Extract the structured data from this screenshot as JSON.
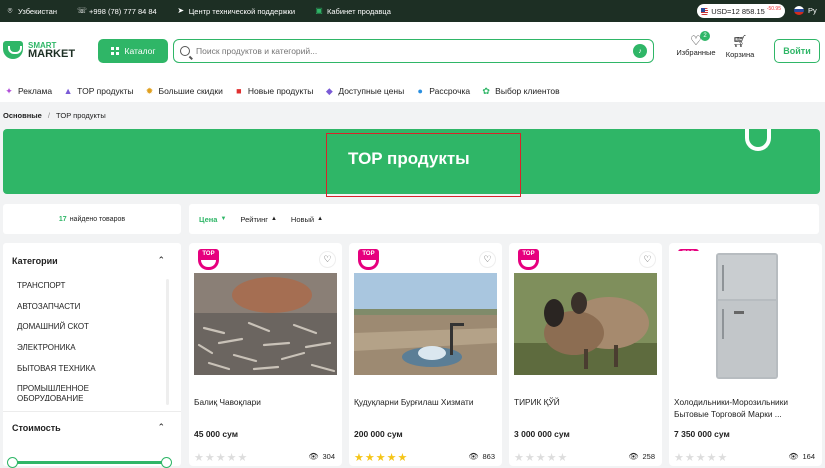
{
  "topbar": {
    "region": "Узбекистан",
    "phone": "+998 (78) 777 84 84",
    "support": "Центр технической поддержки",
    "seller": "Кабинет продавца",
    "currency": "USD=12 858.15",
    "currency_delta": "-50.95",
    "lang": "Ру"
  },
  "header": {
    "logo_line1": "SMART",
    "logo_line2": "MARKET",
    "catalog": "Каталог",
    "search_placeholder": "Поиск продуктов и категорий...",
    "favorites": "Избранные",
    "favorites_count": "2",
    "cart": "Корзина",
    "login": "Войти"
  },
  "nav": [
    {
      "label": "Реклама",
      "icon": "megaphone-icon",
      "glyph": "✦",
      "color": "#b04fd8"
    },
    {
      "label": "TOP продукты",
      "icon": "top-icon",
      "glyph": "▲",
      "color": "#7a5bd6"
    },
    {
      "label": "Большие скидки",
      "icon": "discount-icon",
      "glyph": "✹",
      "color": "#e0a020"
    },
    {
      "label": "Новые продукты",
      "icon": "new-icon",
      "glyph": "■",
      "color": "#e03030"
    },
    {
      "label": "Доступные цены",
      "icon": "price-tag-icon",
      "glyph": "◆",
      "color": "#7a5bd6"
    },
    {
      "label": "Рассрочка",
      "icon": "installment-icon",
      "glyph": "●",
      "color": "#2a8fe0"
    },
    {
      "label": "Выбор клиентов",
      "icon": "clients-choice-icon",
      "glyph": "✿",
      "color": "#2fb667"
    }
  ],
  "breadcrumb": {
    "home": "Основные",
    "current": "TOP продукты"
  },
  "banner": {
    "title": "TOP продукты"
  },
  "found": {
    "count": "17",
    "text": "найдено товаров"
  },
  "sorts": [
    {
      "label": "Цена",
      "arrow": "▼",
      "active": true
    },
    {
      "label": "Рейтинг",
      "arrow": "▲",
      "active": false
    },
    {
      "label": "Новый",
      "arrow": "▲",
      "active": false
    }
  ],
  "sidebar": {
    "categories_title": "Категории",
    "categories": [
      "ТРАНСПОРТ",
      "АВТОЗАПЧАСТИ",
      "ДОМАШНИЙ СКОТ",
      "ЭЛЕКТРОНИКА",
      "БЫТОВАЯ ТЕХНИКА",
      "ПРОМЫШЛЕННОЕ ОБОРУДОВАНИЕ"
    ],
    "price_title": "Стоимость"
  },
  "products": [
    {
      "badge": "TOP",
      "name": "Балиқ Чавоқлари",
      "price": "45 000 сум",
      "rating": 0,
      "views": "304"
    },
    {
      "badge": "TOP",
      "name": "Қудуқларни Бурғилаш Хизмати",
      "price": "200 000 сум",
      "rating": 5,
      "views": "863"
    },
    {
      "badge": "TOP",
      "name": "ТИРИК ҚЎЙ",
      "price": "3 000 000 сум",
      "rating": 0,
      "views": "258"
    },
    {
      "badge": "TOP",
      "name": "Холодильники-Морозильники Бытовые Торговой Марки ...",
      "price": "7 350 000 сум",
      "rating": 0,
      "views": "164"
    }
  ],
  "colors": {
    "accent": "#2fb667",
    "dark": "#1d2f24",
    "top_badge": "#e6007e",
    "highlight": "#d8232a"
  }
}
